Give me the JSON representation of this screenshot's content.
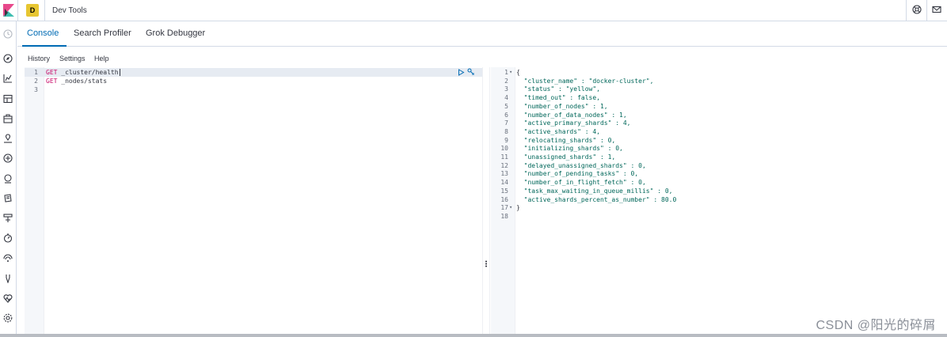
{
  "header": {
    "space_initial": "D",
    "app_title": "Dev Tools",
    "icons": [
      "help-icon",
      "mail-icon"
    ]
  },
  "sidenav": {
    "icons": [
      "recent-icon",
      "discover-icon",
      "visualize-icon",
      "dashboard-icon",
      "canvas-icon",
      "maps-icon",
      "ml-icon",
      "apm-icon",
      "logs-icon",
      "infra-icon",
      "uptime-icon",
      "siem-icon",
      "devtools-icon",
      "monitoring-icon",
      "management-icon"
    ]
  },
  "tabs": [
    {
      "label": "Console",
      "active": true
    },
    {
      "label": "Search Profiler",
      "active": false
    },
    {
      "label": "Grok Debugger",
      "active": false
    }
  ],
  "submenu": [
    "History",
    "Settings",
    "Help"
  ],
  "request_editor": {
    "lines": [
      {
        "n": "1",
        "method": "GET",
        "path": " _cluster/health"
      },
      {
        "n": "2",
        "method": "GET",
        "path": " _nodes/stats"
      },
      {
        "n": "3",
        "method": "",
        "path": ""
      }
    ]
  },
  "response_editor": {
    "lines": [
      {
        "n": "1",
        "fold": "▾",
        "text": "{"
      },
      {
        "n": "2",
        "fold": "",
        "text": "  \"cluster_name\" : \"docker-cluster\","
      },
      {
        "n": "3",
        "fold": "",
        "text": "  \"status\" : \"yellow\","
      },
      {
        "n": "4",
        "fold": "",
        "text": "  \"timed_out\" : false,"
      },
      {
        "n": "5",
        "fold": "",
        "text": "  \"number_of_nodes\" : 1,"
      },
      {
        "n": "6",
        "fold": "",
        "text": "  \"number_of_data_nodes\" : 1,"
      },
      {
        "n": "7",
        "fold": "",
        "text": "  \"active_primary_shards\" : 4,"
      },
      {
        "n": "8",
        "fold": "",
        "text": "  \"active_shards\" : 4,"
      },
      {
        "n": "9",
        "fold": "",
        "text": "  \"relocating_shards\" : 0,"
      },
      {
        "n": "10",
        "fold": "",
        "text": "  \"initializing_shards\" : 0,"
      },
      {
        "n": "11",
        "fold": "",
        "text": "  \"unassigned_shards\" : 1,"
      },
      {
        "n": "12",
        "fold": "",
        "text": "  \"delayed_unassigned_shards\" : 0,"
      },
      {
        "n": "13",
        "fold": "",
        "text": "  \"number_of_pending_tasks\" : 0,"
      },
      {
        "n": "14",
        "fold": "",
        "text": "  \"number_of_in_flight_fetch\" : 0,"
      },
      {
        "n": "15",
        "fold": "",
        "text": "  \"task_max_waiting_in_queue_millis\" : 0,"
      },
      {
        "n": "16",
        "fold": "",
        "text": "  \"active_shards_percent_as_number\" : 80.0"
      },
      {
        "n": "17",
        "fold": "▾",
        "text": "}"
      },
      {
        "n": "18",
        "fold": "",
        "text": ""
      }
    ]
  },
  "watermark": "CSDN @阳光的碎屑",
  "colors": {
    "accent": "#006bb4",
    "method": "#c80a68",
    "json_string": "#00675a",
    "space_badge": "#e7c631"
  }
}
